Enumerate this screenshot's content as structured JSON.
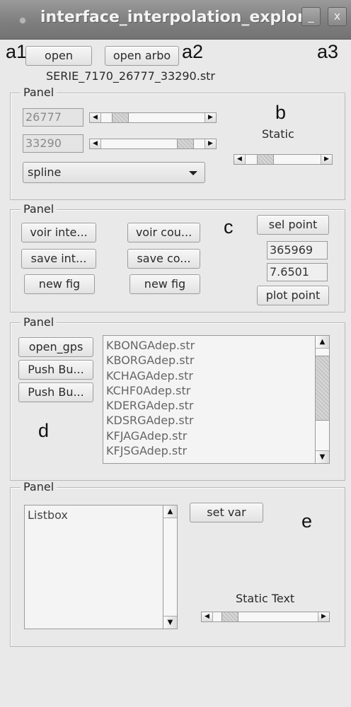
{
  "window": {
    "title": "interface_interpolation_explor",
    "minimize_glyph": "_",
    "close_glyph": "x"
  },
  "annotations": {
    "a1": "a1",
    "a2": "a2",
    "a3": "a3",
    "b": "b",
    "c": "c",
    "d": "d",
    "e": "e"
  },
  "top": {
    "open_label": "open",
    "open_arbo_label": "open arbo",
    "file_name": "SERIE_7170_26777_33290.str"
  },
  "panel1": {
    "title": "Panel",
    "value1": "26777",
    "value2": "33290",
    "static_label": "Static",
    "method_selected": "spline",
    "slider1_level": 0.12,
    "slider2_level": 0.88,
    "slider3_level": 0.2
  },
  "panel2": {
    "title": "Panel",
    "voir_inte_label": "voir inte...",
    "voir_cou_label": "voir cou...",
    "save_int_label": "save int...",
    "save_co_label": "save co...",
    "new_fig1_label": "new fig",
    "new_fig2_label": "new fig",
    "sel_point_label": "sel point",
    "value1": "365969",
    "value2": "7.6501",
    "plot_point_label": "plot point"
  },
  "panel3": {
    "title": "Panel",
    "open_gps_label": "open_gps",
    "push1_label": "Push Bu...",
    "push2_label": "Push Bu...",
    "files": [
      "KBONGAdep.str",
      "KBORGAdep.str",
      "KCHAGAdep.str",
      "KCHF0Adep.str",
      "KDERGAdep.str",
      "KDSRGAdep.str",
      "KFJAGAdep.str",
      "KFJSGAdep.str"
    ]
  },
  "panel4": {
    "title": "Panel",
    "listbox_item": "Listbox",
    "set_var_label": "set var",
    "static_text": "Static Text",
    "slider_level": 0.1
  }
}
